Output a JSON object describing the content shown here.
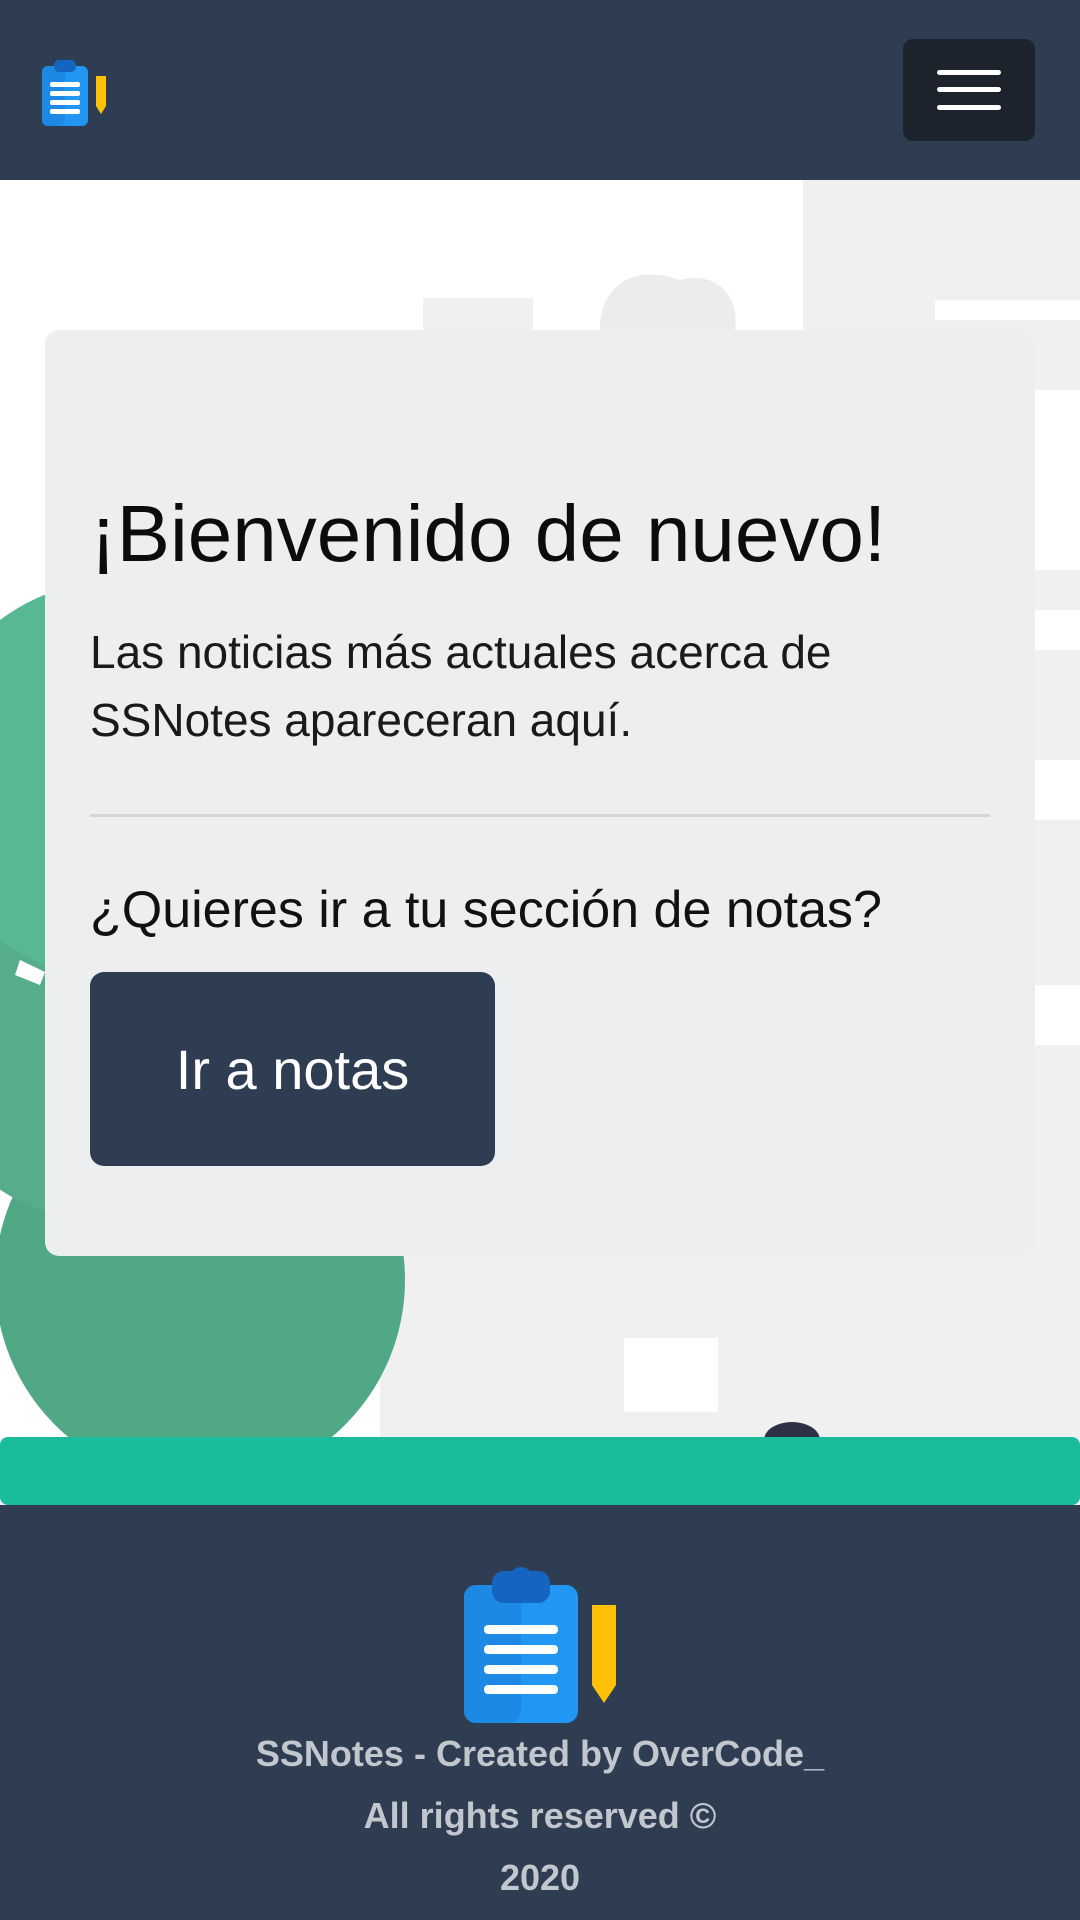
{
  "navbar": {
    "logo_icon": "clipboard-pencil-icon",
    "menu_icon": "hamburger-menu-icon"
  },
  "hero": {
    "title": "¡Bienvenido de nuevo!",
    "lead": "Las noticias más actuales acerca de SSNotes apareceran aquí.",
    "question": "¿Quieres ir a tu sección de notas?",
    "button_label": "Ir a notas"
  },
  "footer": {
    "logo_icon": "clipboard-pencil-icon",
    "credit": "SSNotes - Created by OverCode_",
    "rights": "All rights reserved ©",
    "year": "2020"
  },
  "colors": {
    "navbar": "#2e3d51",
    "accent": "#1abc9c",
    "card": "#eceef0",
    "logo_blue": "#2196f3",
    "pencil_yellow": "#ffc107"
  }
}
